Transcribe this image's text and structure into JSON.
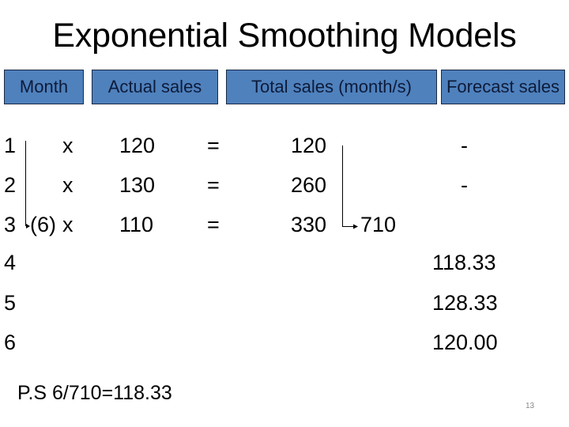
{
  "slide": {
    "title": "Exponential Smoothing Models",
    "page_number": "13",
    "header_fill_color": "#4F81BD"
  },
  "headers": {
    "month": "Month",
    "actual_sales": "Actual sales",
    "total_sales": "Total sales (month/s)",
    "forecast_sales": "Forecast sales"
  },
  "rows": [
    {
      "month": "1",
      "times": "x",
      "actual": "120",
      "eq": "=",
      "total": "120",
      "forecast": "-"
    },
    {
      "month": "2",
      "times": "x",
      "actual": "130",
      "eq": "=",
      "total": "260",
      "forecast": "-"
    },
    {
      "month": "3",
      "months_count": "(6)",
      "times": "x",
      "actual": "110",
      "eq": "=",
      "total": "330",
      "grand_total": "710"
    },
    {
      "month": "4",
      "forecast": "118.33"
    },
    {
      "month": "5",
      "forecast": "128.33"
    },
    {
      "month": "6",
      "forecast": "120.00"
    }
  ],
  "note": "P.S  6/710=118.33"
}
